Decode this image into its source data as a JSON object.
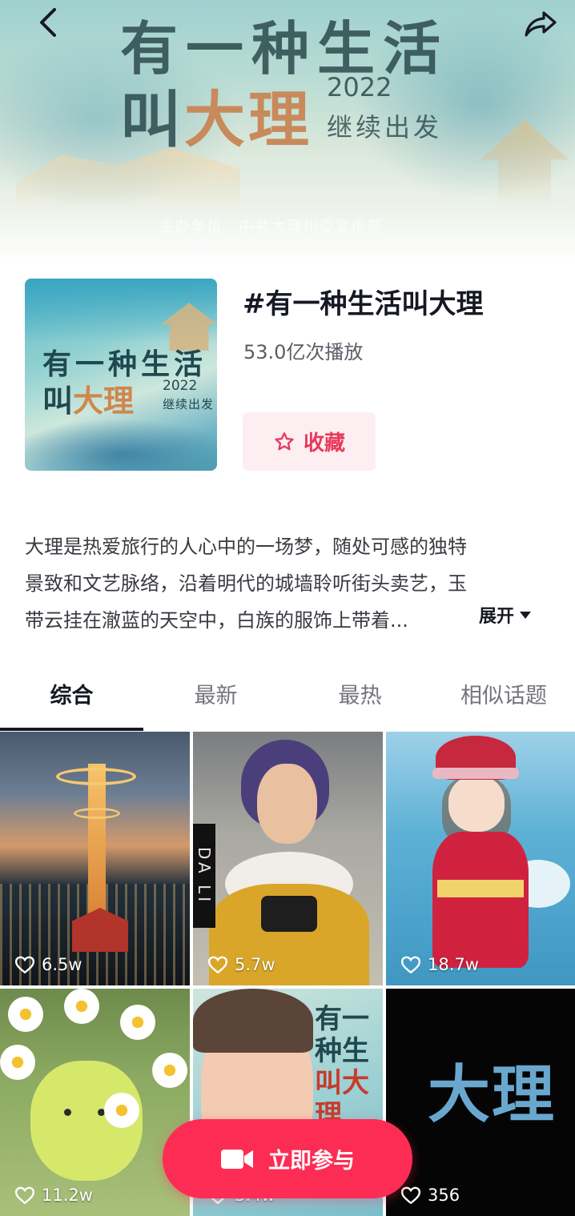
{
  "banner": {
    "title_line1": "有一种生活",
    "title_line2_a": "叫",
    "title_line2_b": "大理",
    "year": "2022",
    "subtitle": "继续出发",
    "organizer": "主办单位：中共大理州委宣传部"
  },
  "nav": {
    "back_icon": "chevron-left-icon",
    "share_icon": "share-arrow-icon"
  },
  "cover": {
    "line1": "有一种生活",
    "line2_a": "叫",
    "line2_b": "大理",
    "year": "2022",
    "subtitle": "继续出发"
  },
  "topic": {
    "title": "#有一种生活叫大理",
    "plays": "53.0亿次播放",
    "favorite_label": "收藏",
    "favorite_icon": "star-outline-icon"
  },
  "description": {
    "lines": [
      "大理是热爱旅行的人心中的一场梦，随处可感的独特",
      "景致和文艺脉络，沿着明代的城墙聆听街头卖艺，玉",
      "带云挂在澈蓝的天空中，白族的服饰上带着..."
    ],
    "expand_label": "展开"
  },
  "tabs": [
    {
      "label": "综合",
      "active": true
    },
    {
      "label": "最新",
      "active": false
    },
    {
      "label": "最热",
      "active": false
    },
    {
      "label": "相似话题",
      "active": false
    }
  ],
  "videos": [
    {
      "likes": "6.5w"
    },
    {
      "likes": "5.7w",
      "overlay_text": "DA LI"
    },
    {
      "likes": "18.7w"
    },
    {
      "likes": "11.2w"
    },
    {
      "likes": "3.4w",
      "overlay_text_a": "有一种生",
      "overlay_text_b": "叫大理"
    },
    {
      "likes": "356",
      "overlay_text": "大理"
    }
  ],
  "cta": {
    "label": "立即参与",
    "icon": "video-camera-icon"
  },
  "colors": {
    "accent": "#fd2c55",
    "favorite_text": "#e8395b",
    "favorite_bg": "#fdeef1",
    "text_primary": "#161823",
    "text_secondary": "#5b5d66"
  }
}
